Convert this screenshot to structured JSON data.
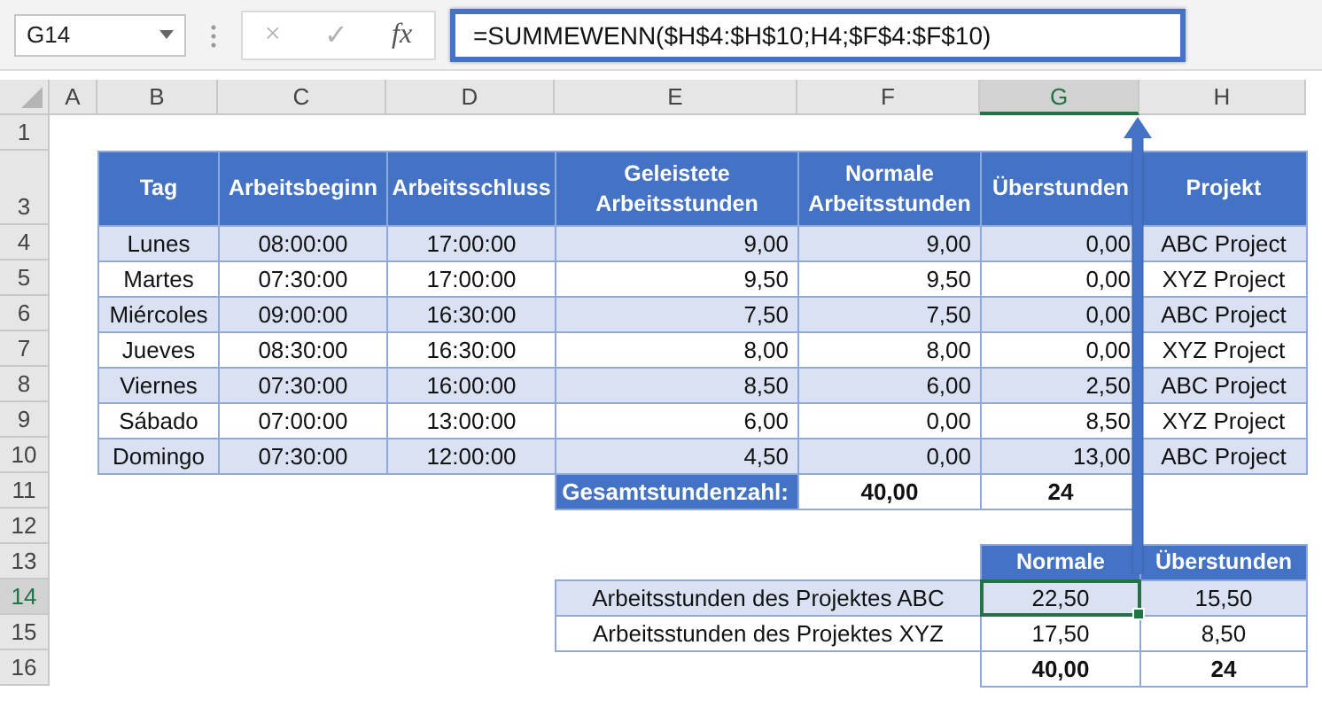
{
  "name_box": "G14",
  "formula_buttons": [
    "×",
    "✓",
    "fx"
  ],
  "formula": "=SUMMEWENN($H$4:$H$10;H4;$F$4:$F$10)",
  "column_headers": [
    {
      "label": "A",
      "selected": false
    },
    {
      "label": "B",
      "selected": false
    },
    {
      "label": "C",
      "selected": false
    },
    {
      "label": "D",
      "selected": false
    },
    {
      "label": "E",
      "selected": false
    },
    {
      "label": "F",
      "selected": false
    },
    {
      "label": "G",
      "selected": true
    },
    {
      "label": "H",
      "selected": false
    }
  ],
  "row_headers": [
    {
      "label": "1",
      "selected": false
    },
    {
      "label": "3",
      "selected": false
    },
    {
      "label": "4",
      "selected": false
    },
    {
      "label": "5",
      "selected": false
    },
    {
      "label": "6",
      "selected": false
    },
    {
      "label": "7",
      "selected": false
    },
    {
      "label": "8",
      "selected": false
    },
    {
      "label": "9",
      "selected": false
    },
    {
      "label": "10",
      "selected": false
    },
    {
      "label": "11",
      "selected": false
    },
    {
      "label": "12",
      "selected": false
    },
    {
      "label": "13",
      "selected": false
    },
    {
      "label": "14",
      "selected": true
    },
    {
      "label": "15",
      "selected": false
    },
    {
      "label": "16",
      "selected": false
    }
  ],
  "main_table": {
    "columns": [
      "Tag",
      "Arbeitsbeginn",
      "Arbeitsschluss",
      "Geleistete Arbeitsstunden",
      "Normale Arbeitsstunden",
      "Überstunden",
      "Projekt"
    ],
    "rows": [
      [
        "Lunes",
        "08:00:00",
        "17:00:00",
        "9,00",
        "9,00",
        "0,00",
        "ABC Project"
      ],
      [
        "Martes",
        "07:30:00",
        "17:00:00",
        "9,50",
        "9,50",
        "0,00",
        "XYZ Project"
      ],
      [
        "Miércoles",
        "09:00:00",
        "16:30:00",
        "7,50",
        "7,50",
        "0,00",
        "ABC Project"
      ],
      [
        "Jueves",
        "08:30:00",
        "16:30:00",
        "8,00",
        "8,00",
        "0,00",
        "XYZ Project"
      ],
      [
        "Viernes",
        "07:30:00",
        "16:00:00",
        "8,50",
        "6,00",
        "2,50",
        "ABC Project"
      ],
      [
        "Sábado",
        "07:00:00",
        "13:00:00",
        "6,00",
        "0,00",
        "8,50",
        "XYZ Project"
      ],
      [
        "Domingo",
        "07:30:00",
        "12:00:00",
        "4,50",
        "0,00",
        "13,00",
        "ABC Project"
      ]
    ],
    "total": {
      "label": "Gesamtstundenzahl:",
      "values": [
        "40,00",
        "24"
      ]
    }
  },
  "summary_table": {
    "columns": [
      "Normale",
      "Überstunden"
    ],
    "rows": [
      {
        "label": "Arbeitsstunden des Projektes ABC",
        "values": [
          {
            "text": "22,50",
            "selected": true
          },
          {
            "text": "15,50",
            "selected": false
          }
        ]
      },
      {
        "label": "Arbeitsstunden des Projektes XYZ",
        "values": [
          {
            "text": "17,50",
            "selected": false
          },
          {
            "text": "8,50",
            "selected": false
          }
        ]
      }
    ],
    "total": [
      "40,00",
      "24"
    ]
  }
}
